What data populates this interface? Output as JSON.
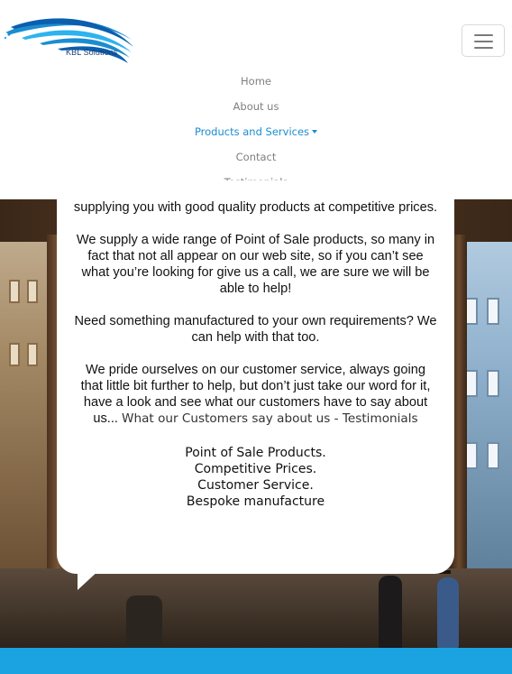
{
  "brand": {
    "logo_text": "KBL Solutions",
    "logo_colors": [
      "#1b8dd1",
      "#0b5fae",
      "#2db3ee"
    ]
  },
  "navbar": {
    "toggler_icon": "hamburger-icon",
    "links": [
      {
        "label": "Home",
        "active": false
      },
      {
        "label": "About us",
        "active": false
      },
      {
        "label": "Products and Services",
        "active": true,
        "dropdown": true
      },
      {
        "label": "Contact",
        "active": false
      },
      {
        "label": "Testimonials",
        "active": false
      }
    ]
  },
  "content": {
    "para1": "supplying you with good quality products at competitive prices.",
    "para2": "We supply a wide range of Point of Sale products, so many in fact that not all appear on our web site, so if you can’t see what you’re looking for give us a call, we are sure we will be able to help!",
    "para3": "Need something manufactured to your own requirements? We can help with that too.",
    "para4_text": "We pride ourselves on our customer service, always going that little bit further to help, but don’t just take our word for it, have a look and see what our customers have to say about us...",
    "para4_link": "What our Customers say about us - Testimonials",
    "taglines": [
      "Point of Sale Products.",
      "Competitive Prices.",
      "Customer Service.",
      "Bespoke manufacture"
    ]
  },
  "colors": {
    "accent": "#1b8dd1",
    "footer": "#1aa3e0",
    "nav_text": "#7f7f7f"
  }
}
